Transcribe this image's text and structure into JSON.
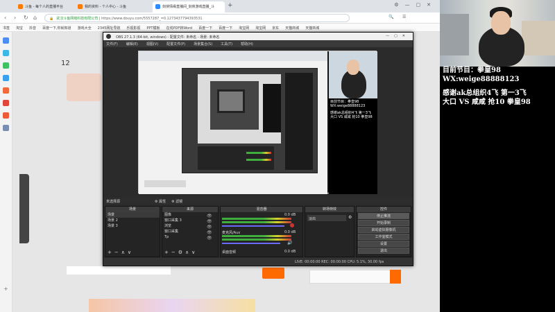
{
  "browser": {
    "tabs": [
      {
        "label": "斗鱼 - 每个人的直播平台",
        "active": false
      },
      {
        "label": "我的资料 - 个人中心 - 斗鱼",
        "active": false
      },
      {
        "label": "剑侠情缘直播间_剑侠游戏直播_斗",
        "active": true
      }
    ],
    "company": "武汉斗鱼网络科技有限公司",
    "url": "https://www.douyu.com/5557287_=0.1273437794393531",
    "bookmarks": [
      "书签",
      "淘宝",
      "抖音",
      "百度一下,你就知道",
      "游戏大全",
      "2345网址导航",
      "乐视影视",
      "PPT模板",
      "在线PDF转Word",
      "百度一下",
      "百度一下",
      "淘宝网",
      "淘宝网",
      "京东",
      "天猫商城",
      "天猫商城"
    ]
  },
  "obs": {
    "title": "OBS 27.1.3 (64-bit, windows) - 配置文件: 未命名 - 场景: 未命名",
    "menu": [
      "文件(F)",
      "编辑(E)",
      "视图(V)",
      "配置文件(P)",
      "场景集合(S)",
      "工具(T)",
      "帮助(H)"
    ],
    "scene_header": "场景",
    "sources_header": "来源",
    "mixer_header": "混音器",
    "transitions_header": "转场特效",
    "controls_header": "控件",
    "scenes": [
      "场景",
      "场景 2",
      "场景 3"
    ],
    "sources": [
      "图像",
      "窗口采集 3",
      "浏览",
      "窗口采集",
      "Tp"
    ],
    "mixer_items": [
      {
        "label": "",
        "level": "0.0 dB"
      },
      {
        "label": "麦克风/Aux",
        "level": "0.0 dB"
      },
      {
        "label": "桌面音频",
        "level": "0.0 dB"
      }
    ],
    "transition": "淡出",
    "controls": [
      "停止推流",
      "开始录制",
      "启动虚拟摄像机",
      "工作室模式",
      "设置",
      "退出"
    ],
    "status": "LIVE: 00:00:00   REC: 00:00:00   CPU: 5.1%, 30.00 fps",
    "scene_label": "未选择源"
  },
  "stream_overlay": {
    "line1": "目前节目：拳皇98",
    "line2": "WX:weige88888123",
    "line3": "感谢ak总组织4飞 第一3飞",
    "line4": "大口 VS 咸咸 抢10 拳皇98"
  },
  "nested_overlay": {
    "l1": "目前节目：拳皇98",
    "l2": "WX:weige88888123",
    "l3": "感谢ak总组织4飞 第一3飞",
    "l4": "大口 VS 咸咸 抢10 拳皇98"
  },
  "page": {
    "count": "12"
  },
  "colors": {
    "accent": "#ff6a00",
    "obs_bg": "#2b2b2b"
  }
}
